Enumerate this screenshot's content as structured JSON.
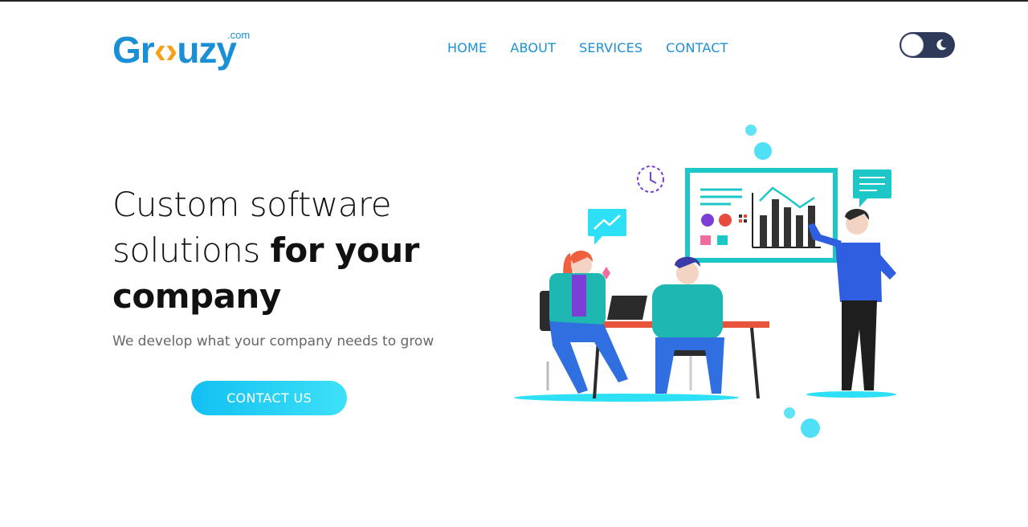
{
  "brand": {
    "logo_prefix": "Gr",
    "logo_middle": "‹›",
    "logo_suffix": "uzy",
    "logo_tld": ".com",
    "primary_color": "#1b8fd6",
    "accent_color": "#f4a21a"
  },
  "nav": {
    "items": [
      {
        "label": "HOME"
      },
      {
        "label": "ABOUT"
      },
      {
        "label": "SERVICES"
      },
      {
        "label": "CONTACT"
      }
    ]
  },
  "theme_toggle": {
    "icon": "moon-icon",
    "track_color": "#2e3a59"
  },
  "hero": {
    "headline_part1": "Custom software solutions ",
    "headline_part2": "for your company",
    "subtitle": "We develop what your company needs to grow",
    "cta_label": "CONTACT US",
    "cta_gradient": [
      "#12c0f2",
      "#3de0f7"
    ]
  },
  "illustration": {
    "icon": "team-meeting-illustration"
  }
}
